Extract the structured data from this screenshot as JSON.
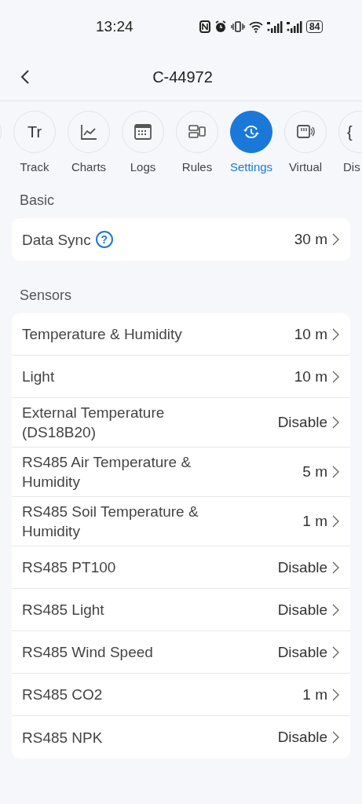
{
  "status_bar": {
    "time": "13:24",
    "battery": "84"
  },
  "header": {
    "title": "C-44972"
  },
  "tabs": [
    {
      "label": "Track",
      "icon": "Tr",
      "kind": "text",
      "selected": false
    },
    {
      "label": "Charts",
      "kind": "chart",
      "selected": false
    },
    {
      "label": "Logs",
      "kind": "calendar",
      "selected": false
    },
    {
      "label": "Rules",
      "kind": "blocks",
      "selected": false
    },
    {
      "label": "Settings",
      "kind": "sync",
      "selected": true
    },
    {
      "label": "Virtual",
      "kind": "device",
      "selected": false
    },
    {
      "label": "Dis",
      "icon": "{",
      "kind": "text",
      "selected": false
    }
  ],
  "sections": [
    {
      "title": "Basic",
      "rows": [
        {
          "label": "Data Sync",
          "help_icon": "?",
          "value": "30 m"
        }
      ]
    },
    {
      "title": "Sensors",
      "rows": [
        {
          "label": "Temperature & Humidity",
          "value": "10 m"
        },
        {
          "label": "Light",
          "value": "10 m"
        },
        {
          "label": "External Temperature (DS18B20)",
          "value": "Disable"
        },
        {
          "label": "RS485 Air Temperature & Humidity",
          "value": "5 m"
        },
        {
          "label": "RS485 Soil Temperature & Humidity",
          "value": "1 m"
        },
        {
          "label": "RS485 PT100",
          "value": "Disable"
        },
        {
          "label": "RS485 Light",
          "value": "Disable"
        },
        {
          "label": "RS485 Wind Speed",
          "value": "Disable"
        },
        {
          "label": "RS485 CO2",
          "value": "1 m"
        },
        {
          "label": "RS485 NPK",
          "value": "Disable"
        }
      ]
    }
  ]
}
